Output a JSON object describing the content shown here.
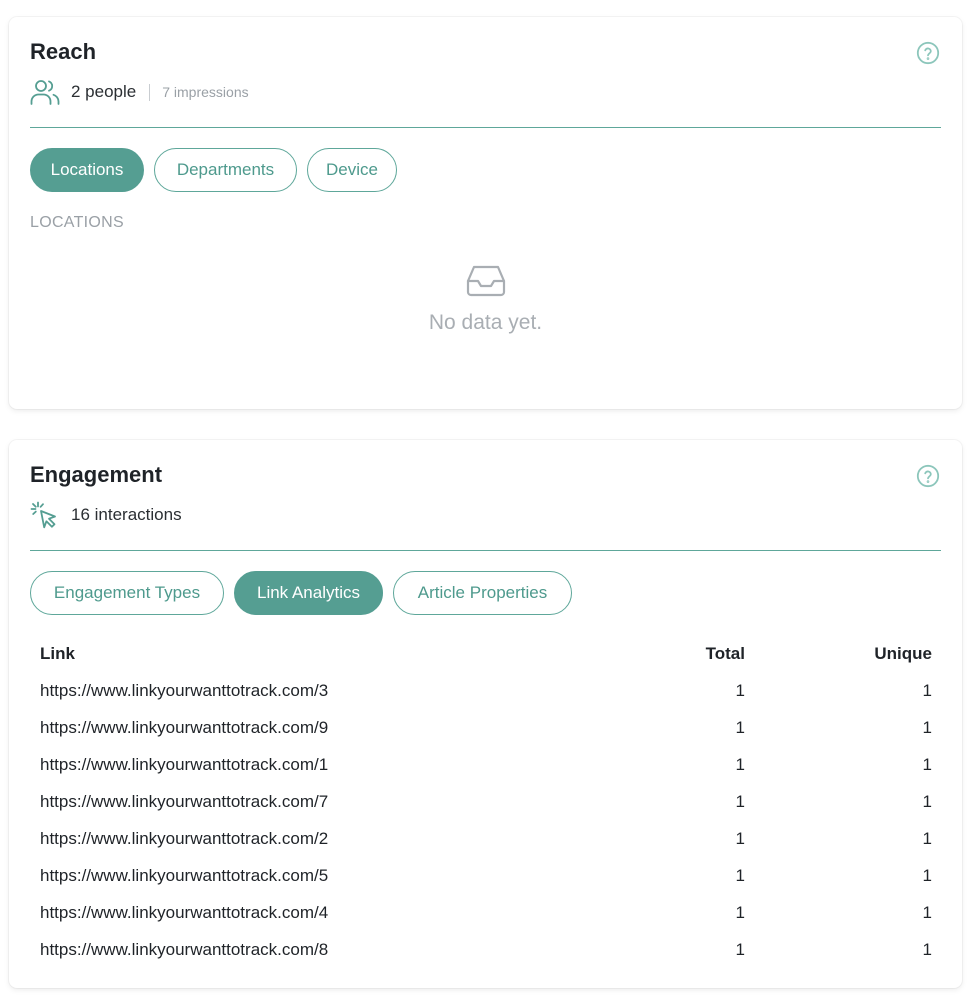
{
  "reach": {
    "title": "Reach",
    "people": "2 people",
    "impressions": "7 impressions",
    "tabs": [
      "Locations",
      "Departments",
      "Device"
    ],
    "active_tab": 0,
    "section_label": "LOCATIONS",
    "empty_text": "No data yet."
  },
  "engagement": {
    "title": "Engagement",
    "interactions": "16 interactions",
    "tabs": [
      "Engagement Types",
      "Link Analytics",
      "Article Properties"
    ],
    "active_tab": 1,
    "table": {
      "headers": [
        "Link",
        "Total",
        "Unique"
      ],
      "rows": [
        [
          "https://www.linkyourwanttotrack.com/3",
          "1",
          "1"
        ],
        [
          "https://www.linkyourwanttotrack.com/9",
          "1",
          "1"
        ],
        [
          "https://www.linkyourwanttotrack.com/1",
          "1",
          "1"
        ],
        [
          "https://www.linkyourwanttotrack.com/7",
          "1",
          "1"
        ],
        [
          "https://www.linkyourwanttotrack.com/2",
          "1",
          "1"
        ],
        [
          "https://www.linkyourwanttotrack.com/5",
          "1",
          "1"
        ],
        [
          "https://www.linkyourwanttotrack.com/4",
          "1",
          "1"
        ],
        [
          "https://www.linkyourwanttotrack.com/8",
          "1",
          "1"
        ]
      ]
    }
  },
  "icons": {
    "help": "help-circle-icon",
    "people": "users-icon",
    "click": "cursor-click-icon",
    "empty": "inbox-icon"
  },
  "colors": {
    "accent": "#559e92",
    "accent_light": "#8cc6bb",
    "muted_text": "#9aa0a6"
  }
}
